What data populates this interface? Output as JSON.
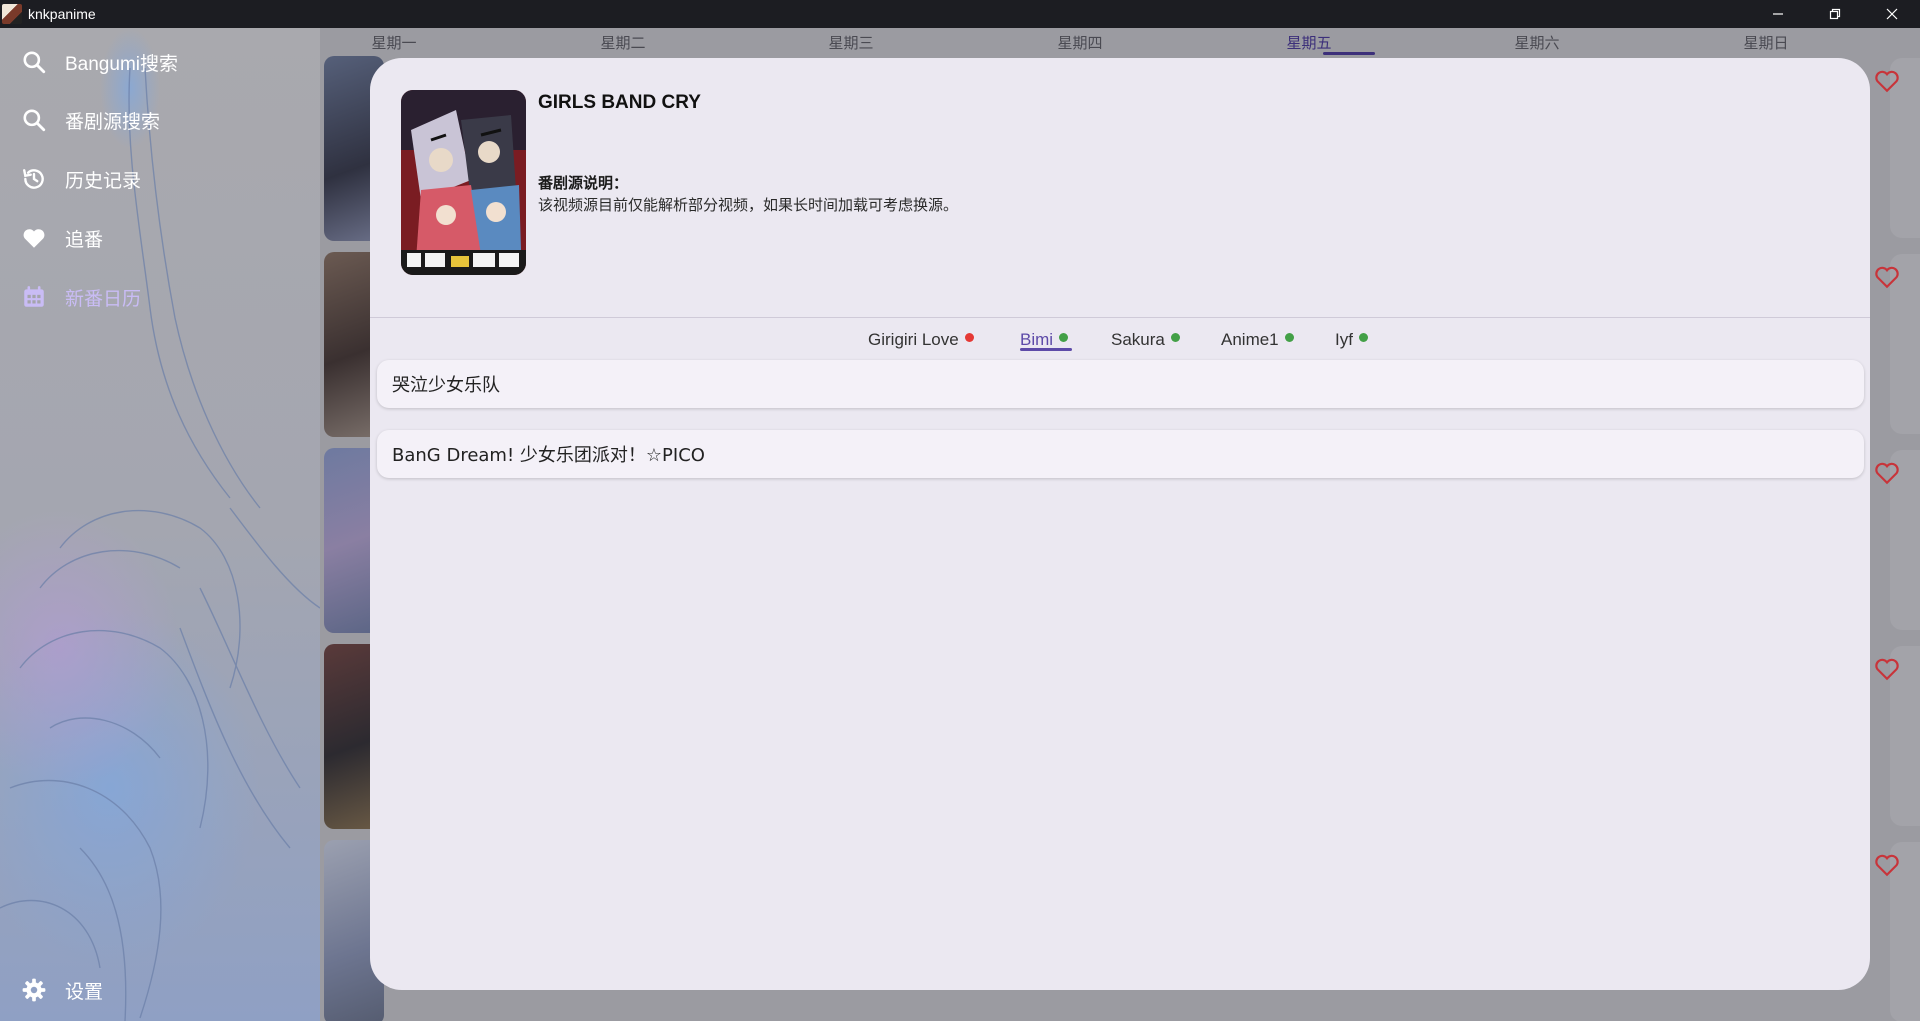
{
  "window": {
    "title": "knkpanime"
  },
  "sidebar": {
    "items": [
      {
        "label": "Bangumi搜索",
        "icon": "search-icon"
      },
      {
        "label": "番剧源搜索",
        "icon": "search-icon"
      },
      {
        "label": "历史记录",
        "icon": "history-icon"
      },
      {
        "label": "追番",
        "icon": "heart-icon"
      },
      {
        "label": "新番日历",
        "icon": "calendar-icon",
        "active": true
      }
    ],
    "settings_label": "设置"
  },
  "calendar": {
    "weekdays": [
      "星期一",
      "星期二",
      "星期三",
      "星期四",
      "星期五",
      "星期六",
      "星期日"
    ],
    "active_weekday": "星期五"
  },
  "dialog": {
    "title": "GIRLS BAND CRY",
    "source_note_label": "番剧源说明：",
    "source_note_text": "该视频源目前仅能解析部分视频，如果长时间加载可考虑换源。",
    "tabs": [
      {
        "label": "Girigiri Love",
        "status_color": "#e53935"
      },
      {
        "label": "Bimi",
        "status_color": "#43a047",
        "active": true
      },
      {
        "label": "Sakura",
        "status_color": "#43a047"
      },
      {
        "label": "Anime1",
        "status_color": "#43a047"
      },
      {
        "label": "Iyf",
        "status_color": "#43a047"
      }
    ],
    "results": [
      "哭泣少女乐队",
      "BanG Dream! 少女乐团派对！☆PICO"
    ]
  },
  "colors": {
    "accent": "#5d4aa8",
    "heart": "#d03a3a",
    "dialog_bg": "#ebe8f1"
  }
}
